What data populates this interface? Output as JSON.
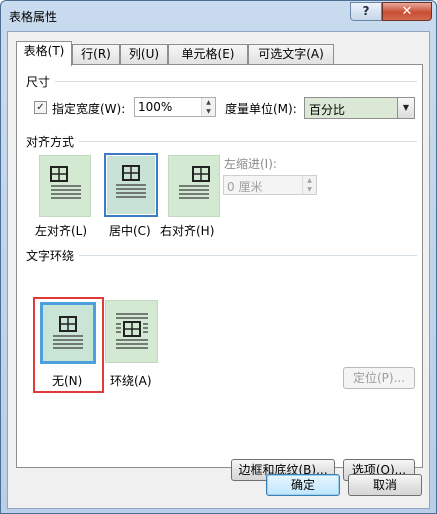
{
  "window": {
    "title": "表格属性",
    "help_label": "?",
    "close_label": "✕"
  },
  "tabs": [
    {
      "label": "表格(T)",
      "active": true
    },
    {
      "label": "行(R)",
      "active": false
    },
    {
      "label": "列(U)",
      "active": false
    },
    {
      "label": "单元格(E)",
      "active": false
    },
    {
      "label": "可选文字(A)",
      "active": false
    }
  ],
  "size": {
    "section_label": "尺寸",
    "preferred_width_checked": true,
    "preferred_width_label": "指定宽度(W):",
    "width_value": "100%",
    "unit_label": "度量单位(M):",
    "unit_value": "百分比"
  },
  "alignment": {
    "section_label": "对齐方式",
    "options": [
      {
        "label": "左对齐(L)",
        "icon": "align-left-icon"
      },
      {
        "label": "居中(C)",
        "icon": "align-center-icon",
        "selected": true
      },
      {
        "label": "右对齐(H)",
        "icon": "align-right-icon"
      }
    ],
    "indent_label": "左缩进(I):",
    "indent_value": "0 厘米"
  },
  "wrapping": {
    "section_label": "文字环绕",
    "options": [
      {
        "label": "无(N)",
        "icon": "wrap-none-icon",
        "selected": true
      },
      {
        "label": "环绕(A)",
        "icon": "wrap-around-icon"
      }
    ],
    "position_button": "定位(P)..."
  },
  "buttons": {
    "borders": "边框和底纹(B)...",
    "options": "选项(O)...",
    "ok": "确定",
    "cancel": "取消"
  },
  "colors": {
    "tile_bg": "#d4e9d1",
    "selection_border": "#3b7cc3",
    "highlight": "#e03a3a"
  }
}
